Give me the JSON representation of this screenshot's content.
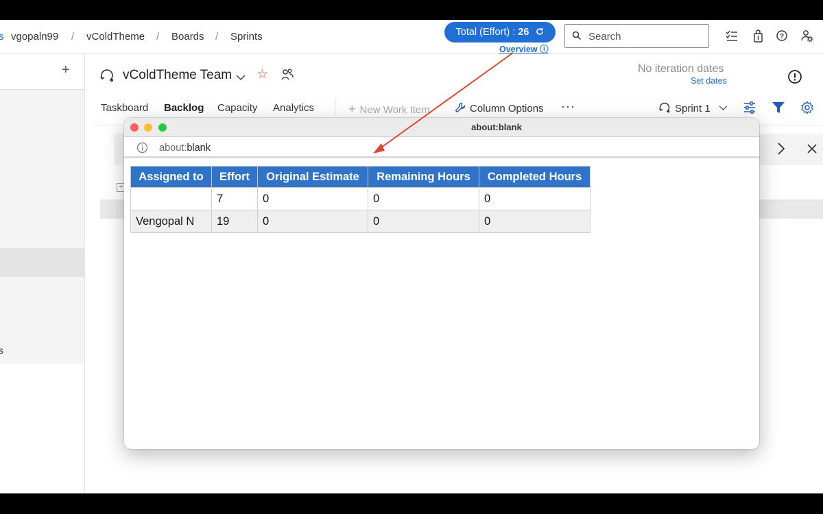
{
  "breadcrumb": {
    "items": [
      "vgopaln99",
      "vColdTheme",
      "Boards",
      "Sprints"
    ],
    "separator": "/"
  },
  "total_pill": {
    "label": "Total (Effort) : ",
    "value": "26",
    "refresh_icon": "refresh-icon"
  },
  "overview_link": "Overview ⓘ",
  "search": {
    "placeholder": "Search",
    "icon": "search-icon"
  },
  "top_icons": [
    "task-list-icon",
    "shopping-bag-icon",
    "help-icon",
    "user-settings-icon"
  ],
  "left_panel": {
    "add_label": "+",
    "truncated_text": "s"
  },
  "team": {
    "name": "vColdTheme Team",
    "favorite_icon": "star-icon",
    "members_icon": "people-icon"
  },
  "iteration": {
    "status": "No iteration dates",
    "set_dates": "Set dates"
  },
  "tabs": [
    {
      "label": "Taskboard",
      "active": false
    },
    {
      "label": "Backlog",
      "active": true
    },
    {
      "label": "Capacity",
      "active": false
    },
    {
      "label": "Analytics",
      "active": false
    }
  ],
  "toolbar": {
    "new_work_item": "New Work Item",
    "column_options": "Column Options",
    "more": "···",
    "sprint": "Sprint 1"
  },
  "popup": {
    "window_title": "about:blank",
    "url_prefix": "about:",
    "url_rest": "blank",
    "table": {
      "headers": [
        "Assigned to",
        "Effort",
        "Original Estimate",
        "Remaining Hours",
        "Completed Hours"
      ],
      "rows": [
        [
          "",
          "7",
          "0",
          "0",
          "0"
        ],
        [
          "Vengopal N",
          "19",
          "0",
          "0",
          "0"
        ]
      ]
    }
  },
  "colors": {
    "accent": "#1f6fd4",
    "table_header": "#2f74c8",
    "annotation_arrow": "#e0462c",
    "favorite_star": "#e0582c"
  }
}
